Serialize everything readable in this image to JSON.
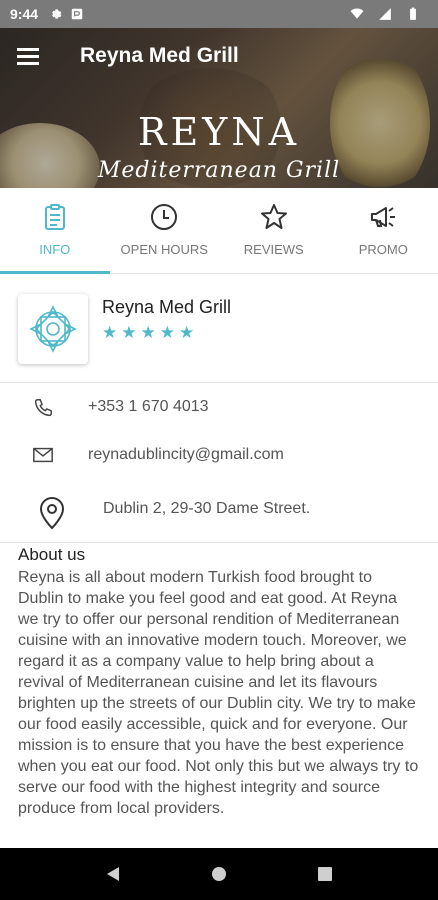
{
  "status_bar": {
    "time": "9:44",
    "icons_left": [
      "gear-icon",
      "card-icon"
    ],
    "icons_right": [
      "wifi-icon",
      "signal-icon",
      "battery-icon"
    ]
  },
  "header": {
    "title": "Reyna Med Grill",
    "hero_logo": "REYNA",
    "hero_subtitle": "Mediterranean Grill"
  },
  "tabs": [
    {
      "label": "INFO",
      "icon": "clipboard-icon",
      "active": true
    },
    {
      "label": "OPEN HOURS",
      "icon": "clock-icon",
      "active": false
    },
    {
      "label": "REVIEWS",
      "icon": "star-outline-icon",
      "active": false
    },
    {
      "label": "PROMO",
      "icon": "megaphone-icon",
      "active": false
    }
  ],
  "profile": {
    "name": "Reyna Med Grill",
    "rating": 5,
    "rating_max": 5
  },
  "contact": {
    "phone": "+353 1 670 4013",
    "email": "reynadublincity@gmail.com",
    "address": "Dublin 2, 29-30 Dame Street."
  },
  "about": {
    "heading": "About us",
    "body": "Reyna is all about modern Turkish food brought to Dublin to make you feel good and eat good. At Reyna we try to offer our personal rendition of Mediterranean cuisine with an innovative modern touch. Moreover, we regard it as a company value to help bring about a revival of Mediterranean cuisine and let its  flavours brighten up the streets of our Dublin city.  We try to make our food easily accessible, quick and for everyone. Our mission is to ensure that you have the best experience when you eat our food.  Not only this but we always try to serve our food with the highest integrity and source produce from local providers."
  },
  "colors": {
    "accent": "#4fb8c9",
    "status_bar": "#7a7a7a",
    "nav_bar": "#000000"
  },
  "navigation": [
    "back-icon",
    "home-icon",
    "recents-icon"
  ]
}
